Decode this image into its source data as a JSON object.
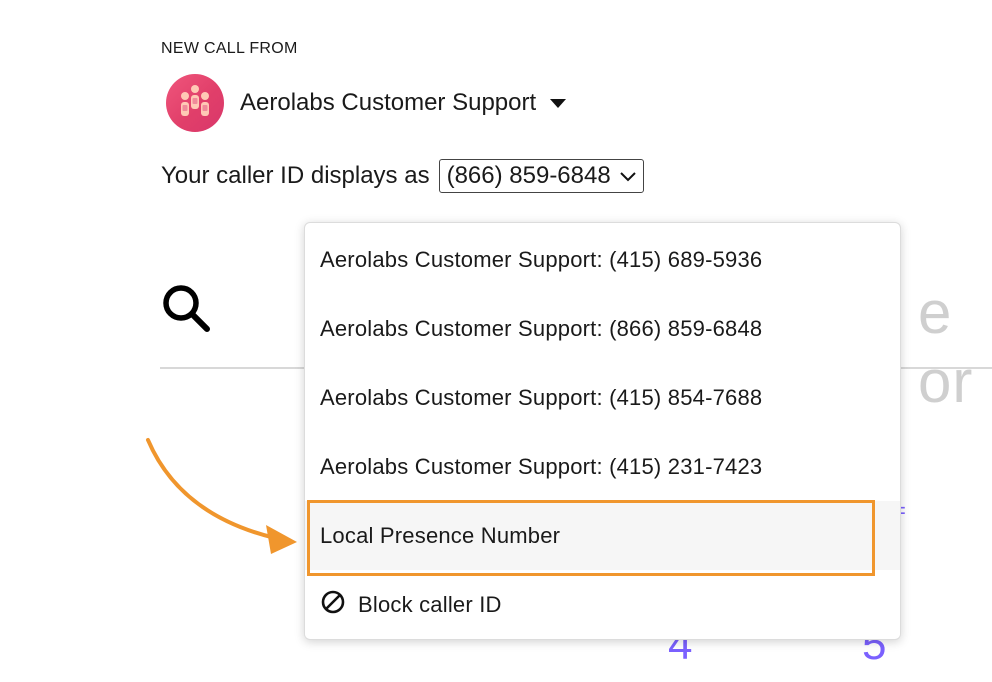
{
  "header": {
    "section_label": "NEW CALL FROM",
    "from_name": "Aerolabs Customer Support"
  },
  "caller_id": {
    "prefix": "Your caller ID displays as",
    "selected_value": "(866) 859-6848"
  },
  "search": {
    "placeholder_visible_tail": "e or"
  },
  "dialpad": {
    "keys": [
      "4",
      "5"
    ]
  },
  "dropdown": {
    "options": [
      {
        "label": "Aerolabs Customer Support: (415) 689-5936"
      },
      {
        "label": "Aerolabs Customer Support: (866) 859-6848"
      },
      {
        "label": "Aerolabs Customer Support: (415) 854-7688"
      },
      {
        "label": "Aerolabs Customer Support: (415) 231-7423"
      },
      {
        "label": "Local Presence Number",
        "highlighted": true
      },
      {
        "label": "Block caller ID",
        "icon": "block-icon"
      }
    ]
  },
  "icons": {
    "avatar": "team-avatar-icon",
    "from_caret": "caret-down-icon",
    "select_chevron": "chevron-down-icon",
    "search": "search-icon",
    "block": "block-icon",
    "annotation": "arrow-annotation-icon"
  },
  "colors": {
    "avatar_gradient_start": "#f0567c",
    "avatar_gradient_end": "#d9376a",
    "highlight_border": "#f0962d",
    "annotation_arrow": "#f0962d",
    "dialpad_accent": "#7b61ff",
    "placeholder_gray": "#cfcfcf"
  }
}
